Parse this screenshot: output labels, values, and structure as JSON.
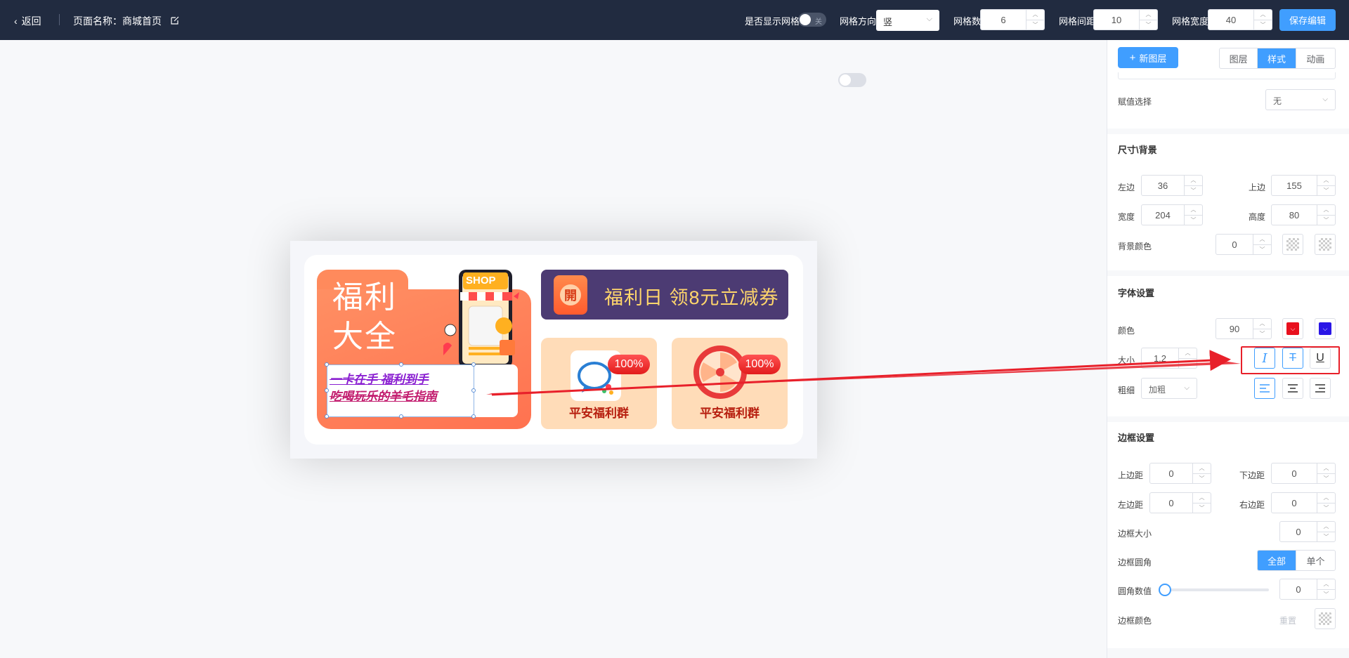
{
  "topbar": {
    "back_label": "返回",
    "page_name": "页面名称：商城首页",
    "show_grid_label": "是否显示网格",
    "show_grid_switch_text": "关",
    "grid_direction_label": "网格方向",
    "grid_direction_value": "竖",
    "grid_count_label": "网格数",
    "grid_count_value": "6",
    "grid_gap_label": "网格间距",
    "grid_gap_value": "10",
    "grid_width_label": "网格宽度",
    "grid_width_value": "40",
    "save_label": "保存编辑"
  },
  "canvas": {
    "fuli_title_1": "福利",
    "fuli_title_2": "大全",
    "shop_sign": "SHOP",
    "text_line_1": "一卡在手 福利到手",
    "text_line_2": "吃喝玩乐的羊毛指南",
    "banner_icon_char": "開",
    "banner_text": "福利日 领8元立减券",
    "tiles": [
      {
        "label": "平安福利群",
        "badge": "100%"
      },
      {
        "label": "平安福利群",
        "badge": "100%"
      }
    ]
  },
  "panel": {
    "new_layer_label": "新图层",
    "tabs": [
      {
        "label": "图层",
        "active": false
      },
      {
        "label": "样式",
        "active": true
      },
      {
        "label": "动画",
        "active": false
      }
    ],
    "assign_label": "赋值选择",
    "assign_value": "无",
    "size_bg_title": "尺寸\\背景",
    "left_label": "左边",
    "left_value": "36",
    "top_label": "上边",
    "top_value": "155",
    "width_label": "宽度",
    "width_value": "204",
    "height_label": "高度",
    "height_value": "80",
    "bg_color_label": "背景颜色",
    "bg_color_value": "0",
    "font_title": "字体设置",
    "color_label": "颜色",
    "color_value": "90",
    "color_1": "#e8101e",
    "color_2": "#2a16e6",
    "size_label": "大小",
    "size_value": "1.2",
    "weight_label": "粗细",
    "weight_value": "加粗",
    "border_title": "边框设置",
    "pad_top_label": "上边距",
    "pad_top_value": "0",
    "pad_bottom_label": "下边距",
    "pad_bottom_value": "0",
    "pad_left_label": "左边距",
    "pad_left_value": "0",
    "pad_right_label": "右边距",
    "pad_right_value": "0",
    "border_size_label": "边框大小",
    "border_size_value": "0",
    "radius_label": "边框圆角",
    "radius_all": "全部",
    "radius_single": "单个",
    "radius_value_label": "圆角数值",
    "radius_value": "0",
    "radius_slider_fraction": 0,
    "border_color_label": "边框颜色",
    "border_color_reset": "重置"
  },
  "colors": {
    "topbar_bg": "#212b40",
    "primary": "#409eff",
    "highlight": "#e8202a"
  }
}
